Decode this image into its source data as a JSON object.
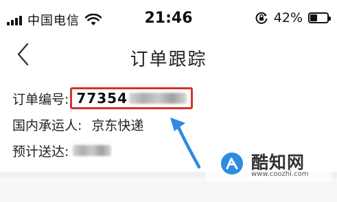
{
  "status_bar": {
    "carrier": "中国电信",
    "time": "21:46",
    "battery_percent": "42%",
    "battery_level": 0.42,
    "icons": [
      "signal-icon",
      "wifi-icon",
      "orientation-lock-icon",
      "battery-icon"
    ]
  },
  "nav": {
    "back_icon": "chevron-left-icon",
    "title": "订单跟踪"
  },
  "order": {
    "number_label": "订单编号:",
    "number_visible": "77354",
    "carrier_label": "国内承运人:",
    "carrier_value": "京东快递",
    "eta_label": "预计送达:"
  },
  "annotation": {
    "highlight_color": "#d9302a",
    "arrow_color": "#2e8be0"
  },
  "watermark": {
    "name": "酷知网",
    "url": "www.coozhi.com",
    "logo_color": "#2e8be0"
  }
}
